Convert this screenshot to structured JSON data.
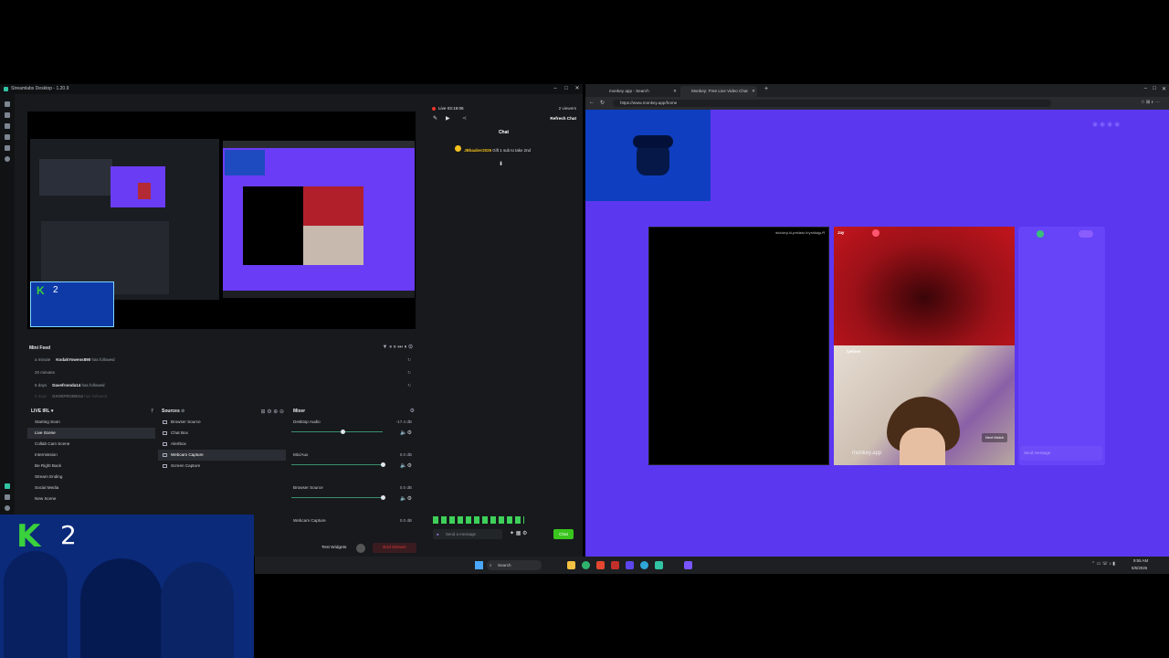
{
  "streamlabs": {
    "title": "Streamlabs Desktop - 1.20.9",
    "minifeed": {
      "title": "Mini Feed",
      "rows": [
        {
          "time": "a minute",
          "user": "KodakYowens890",
          "action": "has followed"
        },
        {
          "time": "20 minutes",
          "user": "",
          "action": ""
        },
        {
          "time": "6 days",
          "user": "Davefromda14",
          "action": "has followed"
        },
        {
          "time": "6 days",
          "user": "DAVEFROMD14",
          "action": "has followed"
        }
      ]
    },
    "scenes": {
      "title": "LIVE IRL",
      "items": [
        "Starting Soon",
        "Live Scene",
        "Collab Cam Scene",
        "Intermission",
        "Be Right Back",
        "Stream Ending",
        "Social Media",
        "New Scene"
      ],
      "active_index": 1
    },
    "sources": {
      "title": "Sources",
      "items": [
        "Browser Source",
        "Chat Box",
        "Alertbox",
        "Webcam Capture",
        "Screen Capture"
      ],
      "active_index": 3
    },
    "mixer": {
      "title": "Mixer",
      "items": [
        {
          "name": "Desktop Audio",
          "db": "-17.4 dB",
          "level": 0.56
        },
        {
          "name": "Mic/Aux",
          "db": "0.0 dB",
          "level": 1.0
        },
        {
          "name": "Browser Source",
          "db": "0.0 dB",
          "level": 1.0
        },
        {
          "name": "Webcam Capture",
          "db": "0.0 dB",
          "level": 1.0
        }
      ]
    },
    "bottom": {
      "test_widgets": "Test Widgets",
      "end_stream": "End Stream"
    },
    "live_status": {
      "time": "Live 03:19:06",
      "viewers": "2 viewers",
      "refresh_chat": "Refresh Chat"
    },
    "chat": {
      "title": "Chat",
      "message_user": "JBbaaber2026",
      "message_text": "Gift 1 sub to take 2nd",
      "input_placeholder": "Send a message",
      "send_label": "Chat"
    }
  },
  "browser": {
    "tabs": [
      "monkey app - Search",
      "Monkey: Free Live Video Chat"
    ],
    "url": "https://www.monkey.app/home",
    "video": {
      "top_username": "Jay",
      "mirrored_label": "Pugtubley!d stableq-ki-ipsidule",
      "bottom_username": "tyelose",
      "watermark": "monkey.app",
      "next_match": "Next Match",
      "send_message_placeholder": "Send message"
    }
  },
  "taskbar": {
    "search_placeholder": "Search",
    "time": "9:55 AM",
    "date": "5/6/2026"
  },
  "colors": {
    "monkey_purple": "#5b37f0",
    "chat_green": "#39c51e",
    "end_stream_red": "#e0353a",
    "live_red": "#f0342a"
  }
}
